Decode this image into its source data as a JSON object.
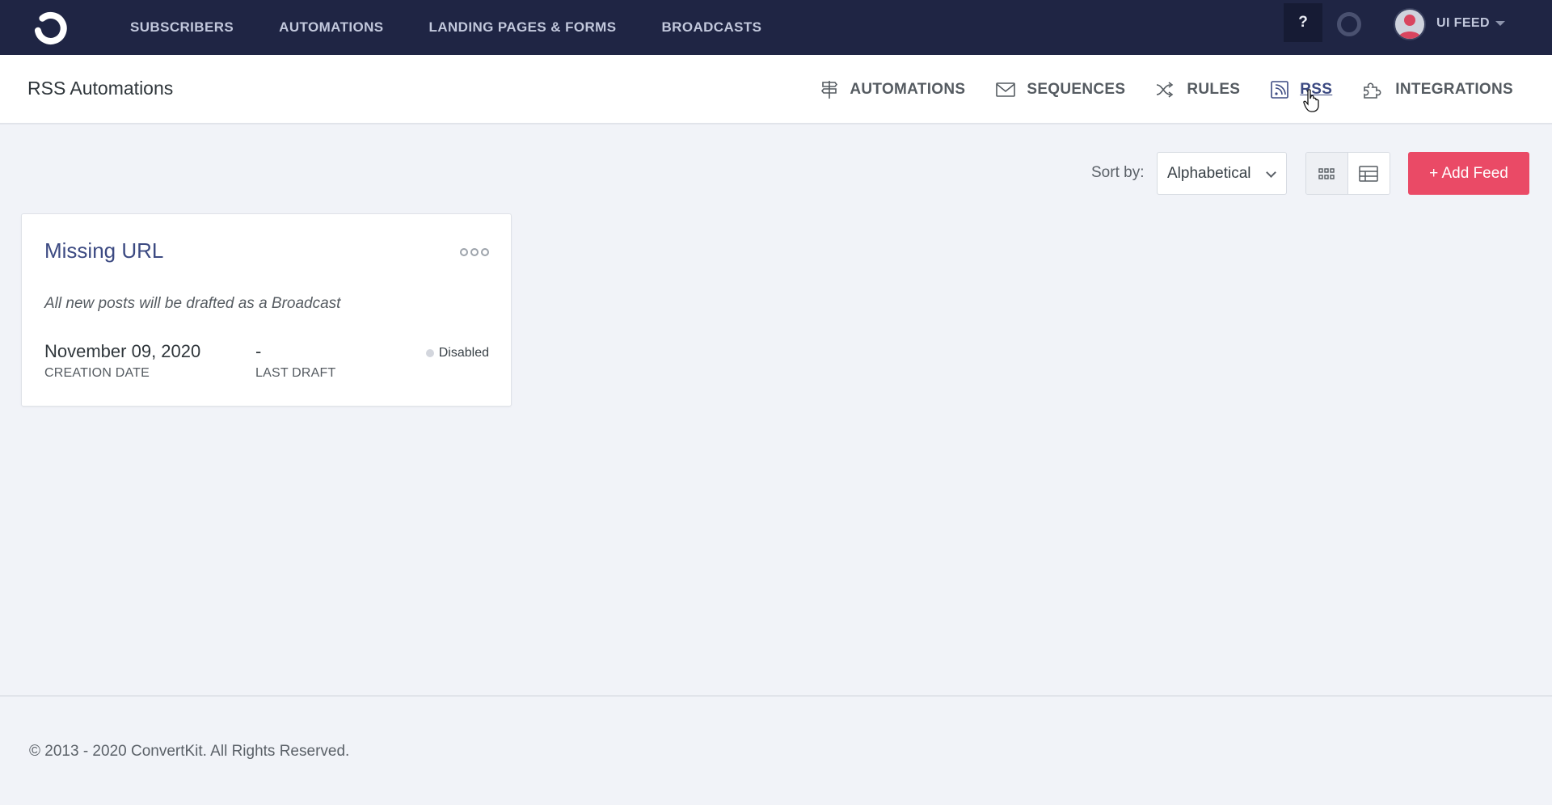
{
  "topnav": {
    "logo": "convertkit-logo",
    "items": [
      {
        "label": "SUBSCRIBERS"
      },
      {
        "label": "AUTOMATIONS"
      },
      {
        "label": "LANDING PAGES & FORMS"
      },
      {
        "label": "BROADCASTS"
      }
    ],
    "help_label": "?",
    "user_name": "UI FEED"
  },
  "subheader": {
    "title": "RSS Automations",
    "tabs": [
      {
        "label": "AUTOMATIONS",
        "icon": "signpost-icon",
        "active": false
      },
      {
        "label": "SEQUENCES",
        "icon": "envelope-icon",
        "active": false
      },
      {
        "label": "RULES",
        "icon": "shuffle-icon",
        "active": false
      },
      {
        "label": "RSS",
        "icon": "rss-icon",
        "active": true
      },
      {
        "label": "INTEGRATIONS",
        "icon": "puzzle-icon",
        "active": false
      }
    ]
  },
  "toolbar": {
    "sort_label": "Sort by:",
    "sort_value": "Alphabetical",
    "view_modes": [
      {
        "name": "grid",
        "icon": "grid-icon",
        "active": true
      },
      {
        "name": "table",
        "icon": "table-icon",
        "active": false
      }
    ],
    "add_feed_label": "+ Add Feed"
  },
  "feeds": [
    {
      "title": "Missing URL",
      "description": "All new posts will be drafted as a Broadcast",
      "creation_date": "November 09, 2020",
      "creation_date_label": "CREATION DATE",
      "last_draft": "-",
      "last_draft_label": "LAST DRAFT",
      "status": "Disabled"
    }
  ],
  "footer": {
    "copyright": "© 2013 - 2020 ConvertKit. All Rights Reserved."
  },
  "colors": {
    "navbar": "#1f2544",
    "accent": "#ea4a66",
    "active_link": "#3c4a82",
    "background": "#f1f3f8",
    "status_disabled": "#d3d6dd"
  }
}
